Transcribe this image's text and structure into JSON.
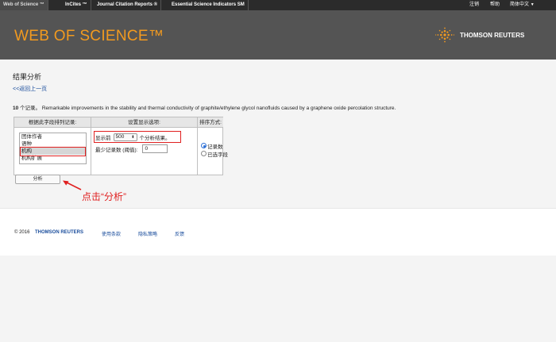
{
  "topnav": {
    "tabs": [
      "Web of Science ™",
      "InCites ™",
      "Journal Citation Reports ®",
      "Essential Science Indicators SM"
    ],
    "right": {
      "logout": "注销",
      "help": "帮助",
      "language": "简体中文"
    }
  },
  "header": {
    "product": "WEB OF SCIENCE™",
    "publisher": "THOMSON REUTERS"
  },
  "page": {
    "title": "结果分析",
    "back_link": "<<返回上一页",
    "summary_count": "10",
    "summary_unit": " 个记录。",
    "summary_text": " Remarkable improvements in the stability and thermal conductivity of graphite/ethylene glycol nanofluids caused by a graphene oxide percolation structure."
  },
  "options": {
    "col1_header": "根据此字段排列记录:",
    "fields": [
      "团体作者",
      "语种",
      "机构",
      "机构扩展"
    ],
    "selected_field": "机构",
    "col2_header": "设置显示选项:",
    "show_prefix": "显示前",
    "show_value": "500",
    "show_suffix": "个分析结果。",
    "min_label": "最少记录数 (阈值):",
    "min_value": "0",
    "col3_header": "排序方式:",
    "sort_options": [
      "记录数",
      "已选字段"
    ],
    "sort_selected": "记录数"
  },
  "analyze_button": "分析",
  "annotation": "点击“分析”",
  "footer": {
    "copyright": "© 2016",
    "brand": "THOMSON REUTERS",
    "links": [
      "使用条款",
      "隐私策略",
      "反馈"
    ]
  },
  "colors": {
    "accent_orange": "#f29a1f",
    "annotation_red": "#e02020",
    "link_blue": "#1a4d9c"
  },
  "icons": {
    "updown": "updown-arrows-icon",
    "tr_mark": "thomson-reuters-logo-icon"
  }
}
